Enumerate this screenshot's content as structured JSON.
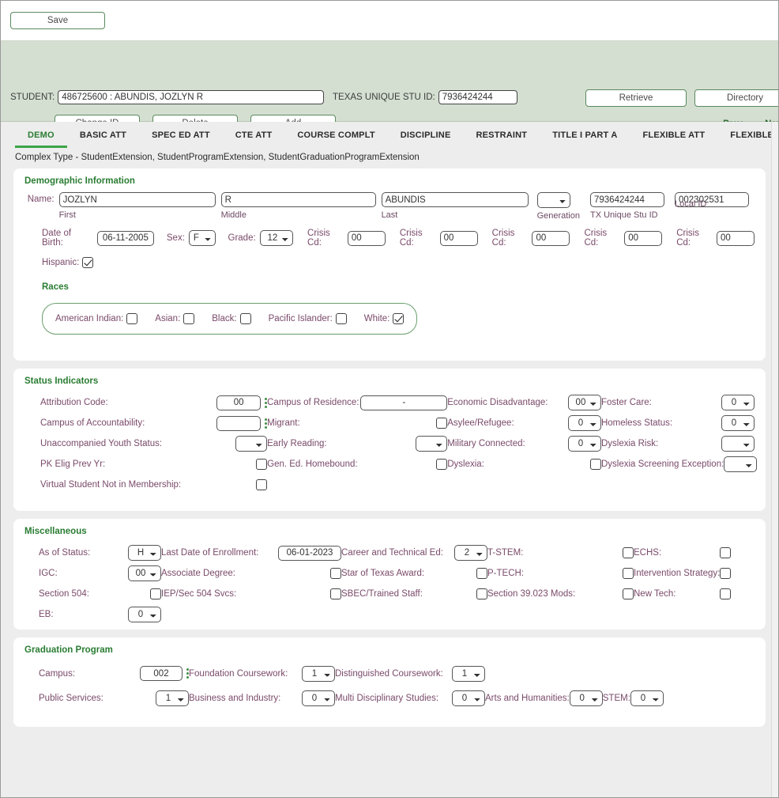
{
  "toolbar": {
    "save_label": "Save"
  },
  "student_header": {
    "student_label": "STUDENT:",
    "student_value": "486725600 : ABUNDIS, JOZLYN R",
    "tx_unique_label": "TEXAS UNIQUE STU ID:",
    "tx_unique_value": "7936424244",
    "change_id_label": "Change ID",
    "delete_label": "Delete",
    "add_label": "Add",
    "retrieve_label": "Retrieve",
    "directory_label": "Directory",
    "prev_label": "Prev",
    "next_label": "Next"
  },
  "tabs": [
    {
      "label": "DEMO",
      "active": true
    },
    {
      "label": "BASIC ATT",
      "active": false
    },
    {
      "label": "SPEC ED ATT",
      "active": false
    },
    {
      "label": "CTE ATT",
      "active": false
    },
    {
      "label": "COURSE COMPLT",
      "active": false
    },
    {
      "label": "DISCIPLINE",
      "active": false
    },
    {
      "label": "RESTRAINT",
      "active": false
    },
    {
      "label": "TITLE I PART A",
      "active": false
    },
    {
      "label": "FLEXIBLE ATT",
      "active": false
    },
    {
      "label": "FLEXIBLE SPEC ED ATT",
      "active": false
    },
    {
      "label": "FLEXIBLE",
      "active": false
    }
  ],
  "complex_type": "Complex Type - StudentExtension, StudentProgramExtension, StudentGraduationProgramExtension",
  "demographic": {
    "title": "Demographic Information",
    "name_label": "Name:",
    "first_value": "JOZLYN",
    "first_caption": "First",
    "middle_value": "R",
    "middle_caption": "Middle",
    "last_value": "ABUNDIS",
    "last_caption": "Last",
    "generation_value": "",
    "generation_caption": "Generation",
    "tx_unique_value": "7936424244",
    "tx_unique_caption": "TX Unique Stu ID",
    "local_id_value": "002302531",
    "local_id_caption": "Local ID",
    "dob_label": "Date of Birth:",
    "dob_value": "06-11-2005",
    "sex_label": "Sex:",
    "sex_value": "F",
    "grade_label": "Grade:",
    "grade_value": "12",
    "crisis_label": "Crisis Cd:",
    "crisis_values": [
      "00",
      "00",
      "00",
      "00",
      "00"
    ],
    "hispanic_label": "Hispanic:",
    "hispanic_checked": true,
    "races_title": "Races",
    "races": [
      {
        "label": "American Indian:",
        "checked": false
      },
      {
        "label": "Asian:",
        "checked": false
      },
      {
        "label": "Black:",
        "checked": false
      },
      {
        "label": "Pacific Islander:",
        "checked": false
      },
      {
        "label": "White:",
        "checked": true
      }
    ]
  },
  "status_indicators": {
    "title": "Status Indicators",
    "col1": [
      {
        "label": "Attribution Code:",
        "type": "text",
        "value": "00",
        "lookup": true
      },
      {
        "label": "Campus of Accountability:",
        "type": "text",
        "value": "",
        "lookup": true
      },
      {
        "label": "Unaccompanied Youth Status:",
        "type": "select",
        "value": ""
      },
      {
        "label": "PK Elig Prev Yr:",
        "type": "check",
        "checked": false
      },
      {
        "label": "Virtual Student Not in Membership:",
        "type": "check",
        "checked": false
      }
    ],
    "col2": [
      {
        "label": "Campus of Residence:",
        "type": "text",
        "value": "-"
      },
      {
        "label": "Migrant:",
        "type": "check",
        "checked": false
      },
      {
        "label": "Early Reading:",
        "type": "select",
        "value": ""
      },
      {
        "label": "Gen. Ed. Homebound:",
        "type": "check",
        "checked": false
      }
    ],
    "col3": [
      {
        "label": "Economic Disadvantage:",
        "type": "select",
        "value": "00"
      },
      {
        "label": "Asylee/Refugee:",
        "type": "select",
        "value": "0"
      },
      {
        "label": "Military Connected:",
        "type": "select",
        "value": "0"
      },
      {
        "label": "Dyslexia:",
        "type": "check",
        "checked": false
      }
    ],
    "col4": [
      {
        "label": "Foster Care:",
        "type": "select",
        "value": "0"
      },
      {
        "label": "Homeless Status:",
        "type": "select",
        "value": "0"
      },
      {
        "label": "Dyslexia Risk:",
        "type": "select",
        "value": ""
      },
      {
        "label": "Dyslexia Screening Exception:",
        "type": "select",
        "value": ""
      }
    ]
  },
  "miscellaneous": {
    "title": "Miscellaneous",
    "col1": [
      {
        "label": "As of Status:",
        "type": "select",
        "value": "H"
      },
      {
        "label": "IGC:",
        "type": "select",
        "value": "00"
      },
      {
        "label": "Section 504:",
        "type": "check",
        "checked": false
      },
      {
        "label": "EB:",
        "type": "select",
        "value": "0"
      }
    ],
    "col2": [
      {
        "label": "Last Date of Enrollment:",
        "type": "text",
        "value": "06-01-2023"
      },
      {
        "label": "Associate Degree:",
        "type": "check",
        "checked": false
      },
      {
        "label": "IEP/Sec 504 Svcs:",
        "type": "check",
        "checked": false
      }
    ],
    "col3": [
      {
        "label": "Career and Technical Ed:",
        "type": "select",
        "value": "2"
      },
      {
        "label": "Star of Texas Award:",
        "type": "check",
        "checked": false
      },
      {
        "label": "SBEC/Trained Staff:",
        "type": "check",
        "checked": false
      }
    ],
    "col4": [
      {
        "label": "T-STEM:",
        "type": "check",
        "checked": false
      },
      {
        "label": "P-TECH:",
        "type": "check",
        "checked": false
      },
      {
        "label": "Section 39.023 Mods:",
        "type": "check",
        "checked": false
      }
    ],
    "col5": [
      {
        "label": "ECHS:",
        "type": "check",
        "checked": false
      },
      {
        "label": "Intervention Strategy:",
        "type": "check",
        "checked": false
      },
      {
        "label": "New Tech:",
        "type": "check",
        "checked": false
      }
    ]
  },
  "graduation_program": {
    "title": "Graduation Program",
    "col1": [
      {
        "label": "Campus:",
        "type": "text",
        "value": "002",
        "lookup": true
      },
      {
        "label": "Public Services:",
        "type": "select",
        "value": "1"
      }
    ],
    "col2": [
      {
        "label": "Foundation Coursework:",
        "type": "select",
        "value": "1"
      },
      {
        "label": "Business and Industry:",
        "type": "select",
        "value": "0"
      }
    ],
    "col3": [
      {
        "label": "Distinguished Coursework:",
        "type": "select",
        "value": "1"
      },
      {
        "label": "Multi Disciplinary Studies:",
        "type": "select",
        "value": "0"
      }
    ],
    "col4": [
      {
        "label": "Arts and Humanities:",
        "type": "select",
        "value": "0"
      }
    ],
    "col5": [
      {
        "label": "STEM:",
        "type": "select",
        "value": "0"
      }
    ]
  },
  "colors": {
    "accent_green": "#2a7d33",
    "header_green": "#d4dfd1",
    "page_gray": "#ededed",
    "label_purple": "#7a4a6a"
  }
}
